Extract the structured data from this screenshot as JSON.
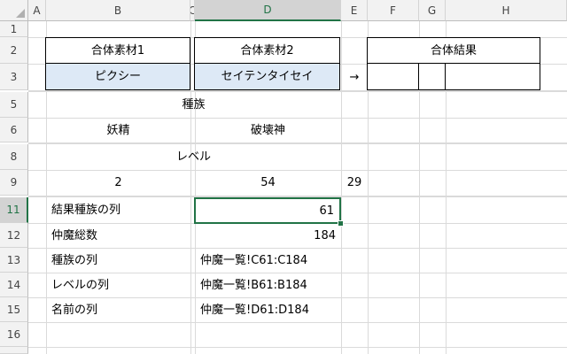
{
  "columns": [
    "A",
    "B",
    "C",
    "D",
    "E",
    "F",
    "G",
    "H"
  ],
  "rows": [
    "1",
    "2",
    "3",
    "5",
    "6",
    "8",
    "9",
    "11",
    "12",
    "13",
    "14",
    "15",
    "16"
  ],
  "cells": {
    "b2": "合体素材1",
    "d2": "合体素材2",
    "fh2": "合体結果",
    "b3": "ピクシー",
    "d3": "セイテンタイセイ",
    "e3": "→",
    "bd5": "種族",
    "b6": "妖精",
    "d6": "破壊神",
    "bd8": "レベル",
    "b9": "2",
    "d9": "54",
    "e9": "29",
    "b11": "結果種族の列",
    "d11": "61",
    "b12": "仲魔総数",
    "d12": "184",
    "b13": "種族の列",
    "d13": "仲魔一覧!C61:C184",
    "b14": "レベルの列",
    "d14": "仲魔一覧!B61:B184",
    "b15": "名前の列",
    "d15": "仲魔一覧!D61:D184"
  },
  "colors": {
    "accent": "#217346",
    "input_fill": "#dde9f6"
  }
}
